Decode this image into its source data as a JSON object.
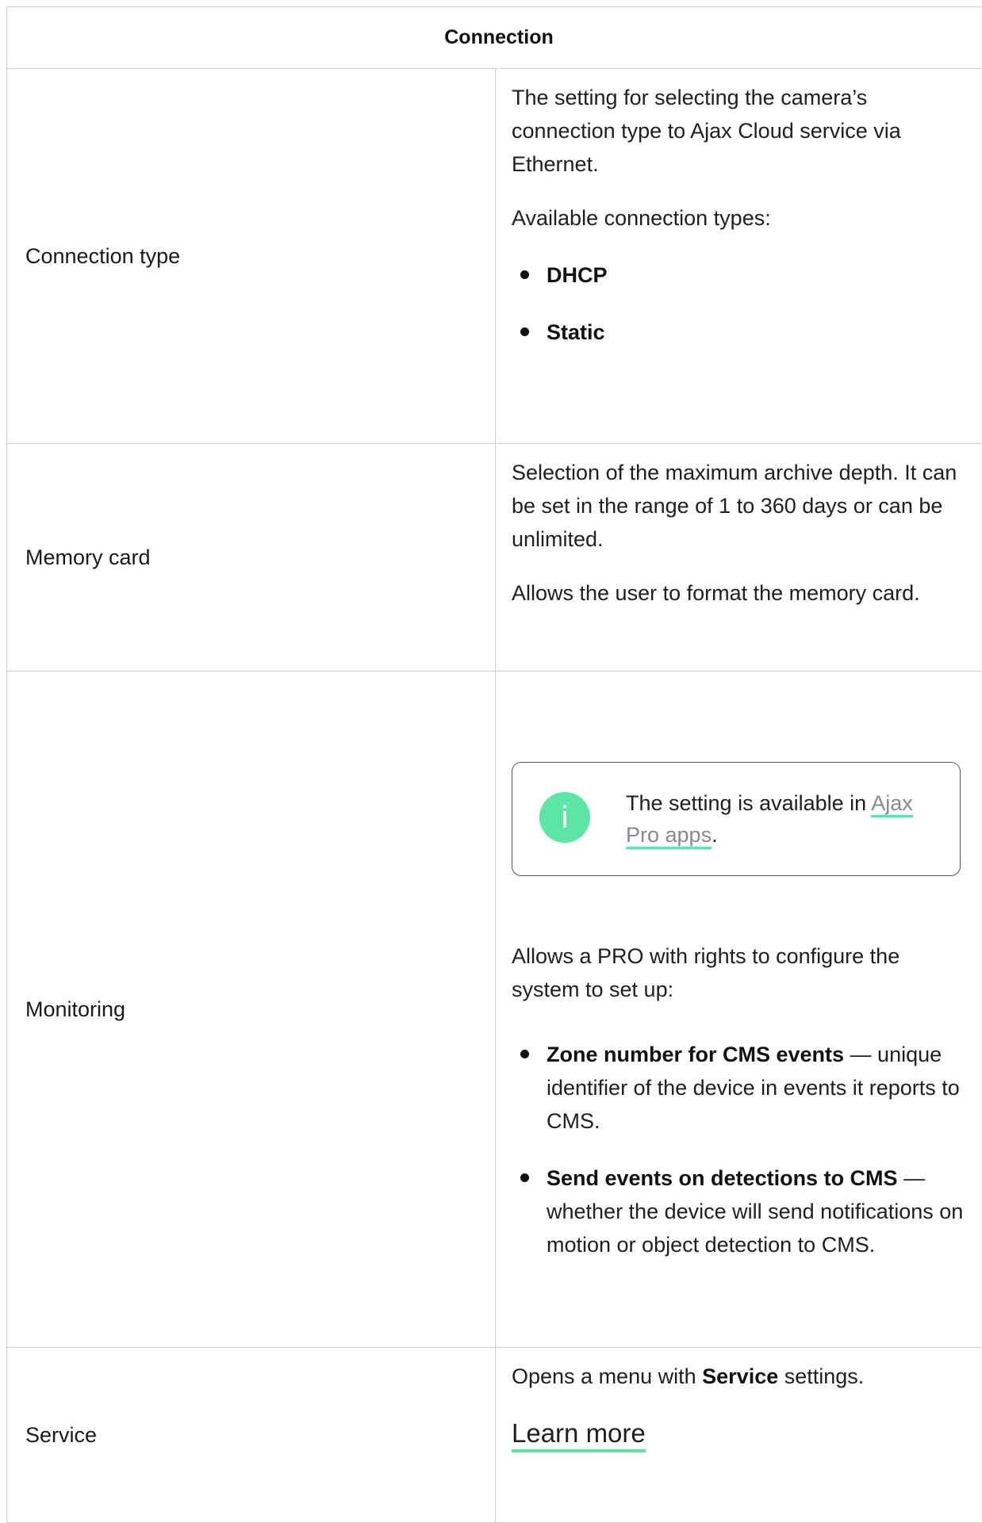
{
  "table": {
    "header": "Connection",
    "rows": {
      "connection_type": {
        "label": "Connection type",
        "desc": "The setting for selecting the camera’s connection type to Ajax Cloud service via Ethernet.",
        "available": "Available connection types:",
        "options": [
          "DHCP",
          "Static"
        ]
      },
      "memory_card": {
        "label": "Memory card",
        "desc1": "Selection of the maximum archive depth. It can be set in the range of 1 to 360 days or can be unlimited.",
        "desc2": "Allows the user to format the memory card."
      },
      "monitoring": {
        "label": "Monitoring",
        "note_prefix": "The setting is available in ",
        "note_link": "Ajax Pro apps",
        "note_suffix": ".",
        "desc": "Allows a PRO with rights to configure the system to set up:",
        "items": [
          {
            "term": "Zone number for CMS events",
            "text": " — unique identifier of the device in events it reports to CMS."
          },
          {
            "term": "Send events on detections to CMS",
            "text": " — whether the device will send notifications on motion or object detection to CMS."
          }
        ]
      },
      "service": {
        "label": "Service",
        "desc_prefix": "Opens a menu with ",
        "desc_bold": "Service",
        "desc_suffix": " settings.",
        "learn_more": "Learn more"
      }
    }
  },
  "colors": {
    "accent": "#5fe4a8",
    "border": "#cfcfcf",
    "link_text": "#8a8a8a"
  },
  "icons": {
    "note_icon": "info-icon"
  }
}
